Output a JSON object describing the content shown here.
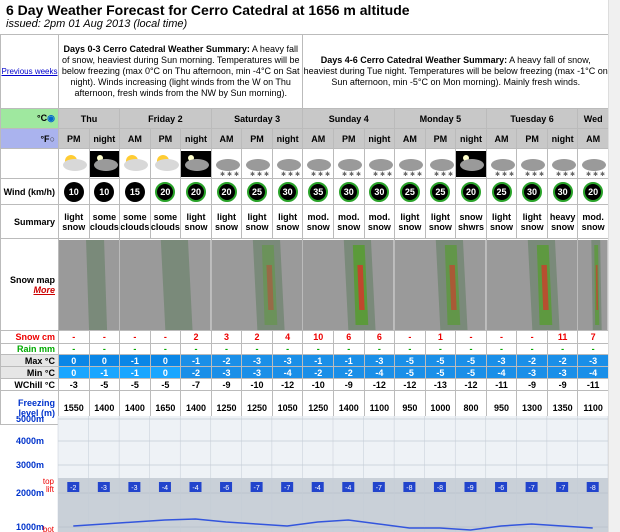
{
  "header": {
    "title": "6 Day Weather Forecast for Cerro Catedral at 1656 m altitude",
    "issued": "issued: 2pm 01 Aug 2013 (local time)"
  },
  "summary": {
    "previous_weeks": "Previous weeks",
    "left_title": "Days 0-3 Cerro Catedral Weather Summary:",
    "left_text": " A heavy fall of snow, heaviest during Sun morning. Temperatures will be below freezing (max 0°C on Thu afternoon, min -4°C on Sat night). Winds increasing (light winds from the W on Thu afternoon, fresh winds from the NW by Sun morning).",
    "right_title": "Days 4-6 Cerro Catedral Weather Summary:",
    "right_text": " A heavy fall of snow, heaviest during Tue night. Temperatures will be below freezing (max -1°C on Sun afternoon, min -5°C on Mon morning). Mainly fresh winds."
  },
  "units": {
    "c": "°C",
    "f": "°F"
  },
  "days": [
    {
      "label": "Thu",
      "span": 2
    },
    {
      "label": "Friday 2",
      "span": 3
    },
    {
      "label": "Saturday 3",
      "span": 3
    },
    {
      "label": "Sunday 4",
      "span": 3
    },
    {
      "label": "Monday 5",
      "span": 3
    },
    {
      "label": "Tuesday 6",
      "span": 3
    },
    {
      "label": "Wed",
      "span": 1
    }
  ],
  "periods": [
    "PM",
    "night",
    "AM",
    "PM",
    "night",
    "AM",
    "PM",
    "night",
    "AM",
    "PM",
    "night",
    "AM",
    "PM",
    "night",
    "AM",
    "PM",
    "night",
    "AM"
  ],
  "icons": [
    "sun-cloud-icon",
    "moon-cloud-icon",
    "sun-cloud-icon",
    "sun-cloud-icon",
    "moon-cloud-icon",
    "snow-cloud-icon",
    "snow-cloud-icon",
    "snow-cloud-icon",
    "snow-cloud-icon",
    "snow-cloud-icon",
    "snow-cloud-icon",
    "snow-cloud-icon",
    "snow-cloud-icon",
    "moon-cloud-icon",
    "snow-cloud-icon",
    "snow-cloud-icon",
    "snow-cloud-icon",
    "snow-cloud-icon"
  ],
  "labels": {
    "wind": "Wind (km/h)",
    "summary": "Summary",
    "snow_map": "Snow map",
    "more": "More",
    "snow": "Snow cm",
    "rain": "Rain mm",
    "max": "Max °C",
    "min": "Min °C",
    "wchill": "WChill °C",
    "freezing": "Freezing level (m)"
  },
  "wind": [
    "10",
    "10",
    "15",
    "20",
    "20",
    "20",
    "25",
    "30",
    "35",
    "30",
    "30",
    "25",
    "25",
    "20",
    "25",
    "30",
    "30",
    "20"
  ],
  "wind_ring_green": [
    false,
    false,
    false,
    true,
    true,
    true,
    true,
    true,
    true,
    true,
    true,
    true,
    true,
    true,
    true,
    true,
    true,
    true
  ],
  "summaries": [
    "light snow",
    "some clouds",
    "some clouds",
    "some clouds",
    "light snow",
    "light snow",
    "light snow",
    "light snow",
    "mod. snow",
    "mod. snow",
    "mod. snow",
    "light snow",
    "light snow",
    "snow shwrs",
    "light snow",
    "light snow",
    "heavy snow",
    "mod. snow"
  ],
  "snow": [
    "-",
    "-",
    "-",
    "-",
    "2",
    "3",
    "2",
    "4",
    "10",
    "6",
    "6",
    "-",
    "1",
    "-",
    "-",
    "-",
    "11",
    "7"
  ],
  "rain": [
    "-",
    "-",
    "-",
    "-",
    "-",
    "-",
    "-",
    "-",
    "-",
    "-",
    "-",
    "-",
    "-",
    "-",
    "-",
    "-",
    "-",
    "-"
  ],
  "max": [
    "0",
    "0",
    "-1",
    "0",
    "-1",
    "-2",
    "-3",
    "-3",
    "-1",
    "-1",
    "-3",
    "-5",
    "-5",
    "-5",
    "-3",
    "-2",
    "-2",
    "-3"
  ],
  "min": [
    "0",
    "-1",
    "-1",
    "0",
    "-2",
    "-3",
    "-3",
    "-4",
    "-2",
    "-2",
    "-4",
    "-5",
    "-5",
    "-5",
    "-4",
    "-3",
    "-3",
    "-4"
  ],
  "wchill": [
    "-3",
    "-5",
    "-5",
    "-5",
    "-7",
    "-9",
    "-10",
    "-12",
    "-10",
    "-9",
    "-12",
    "-12",
    "-13",
    "-12",
    "-11",
    "-9",
    "-9",
    "-11"
  ],
  "freezing": [
    "1550",
    "1400",
    "1400",
    "1650",
    "1400",
    "1250",
    "1250",
    "1050",
    "1250",
    "1400",
    "1100",
    "950",
    "1000",
    "800",
    "950",
    "1300",
    "1350",
    "1100"
  ],
  "chart": {
    "y_labels": [
      "5000m",
      "4000m",
      "3000m",
      "2000m",
      "1000m"
    ],
    "top_lift": [
      "top",
      "lift"
    ],
    "bot": "bot",
    "temps": [
      "-2",
      "-3",
      "-3",
      "-4",
      "-4",
      "-6",
      "-7",
      "-7",
      "-4",
      "-4",
      "-7",
      "-8",
      "-8",
      "-9",
      "-6",
      "-7",
      "-7",
      "-8"
    ]
  },
  "colors": {
    "max_blue": "#0a86e6",
    "min_blue": "#1aa6ff",
    "label_blue": "#0033cc",
    "header_gray": "#c8c8c8",
    "snow_red": "#e00000",
    "rain_green": "#00aa00"
  }
}
